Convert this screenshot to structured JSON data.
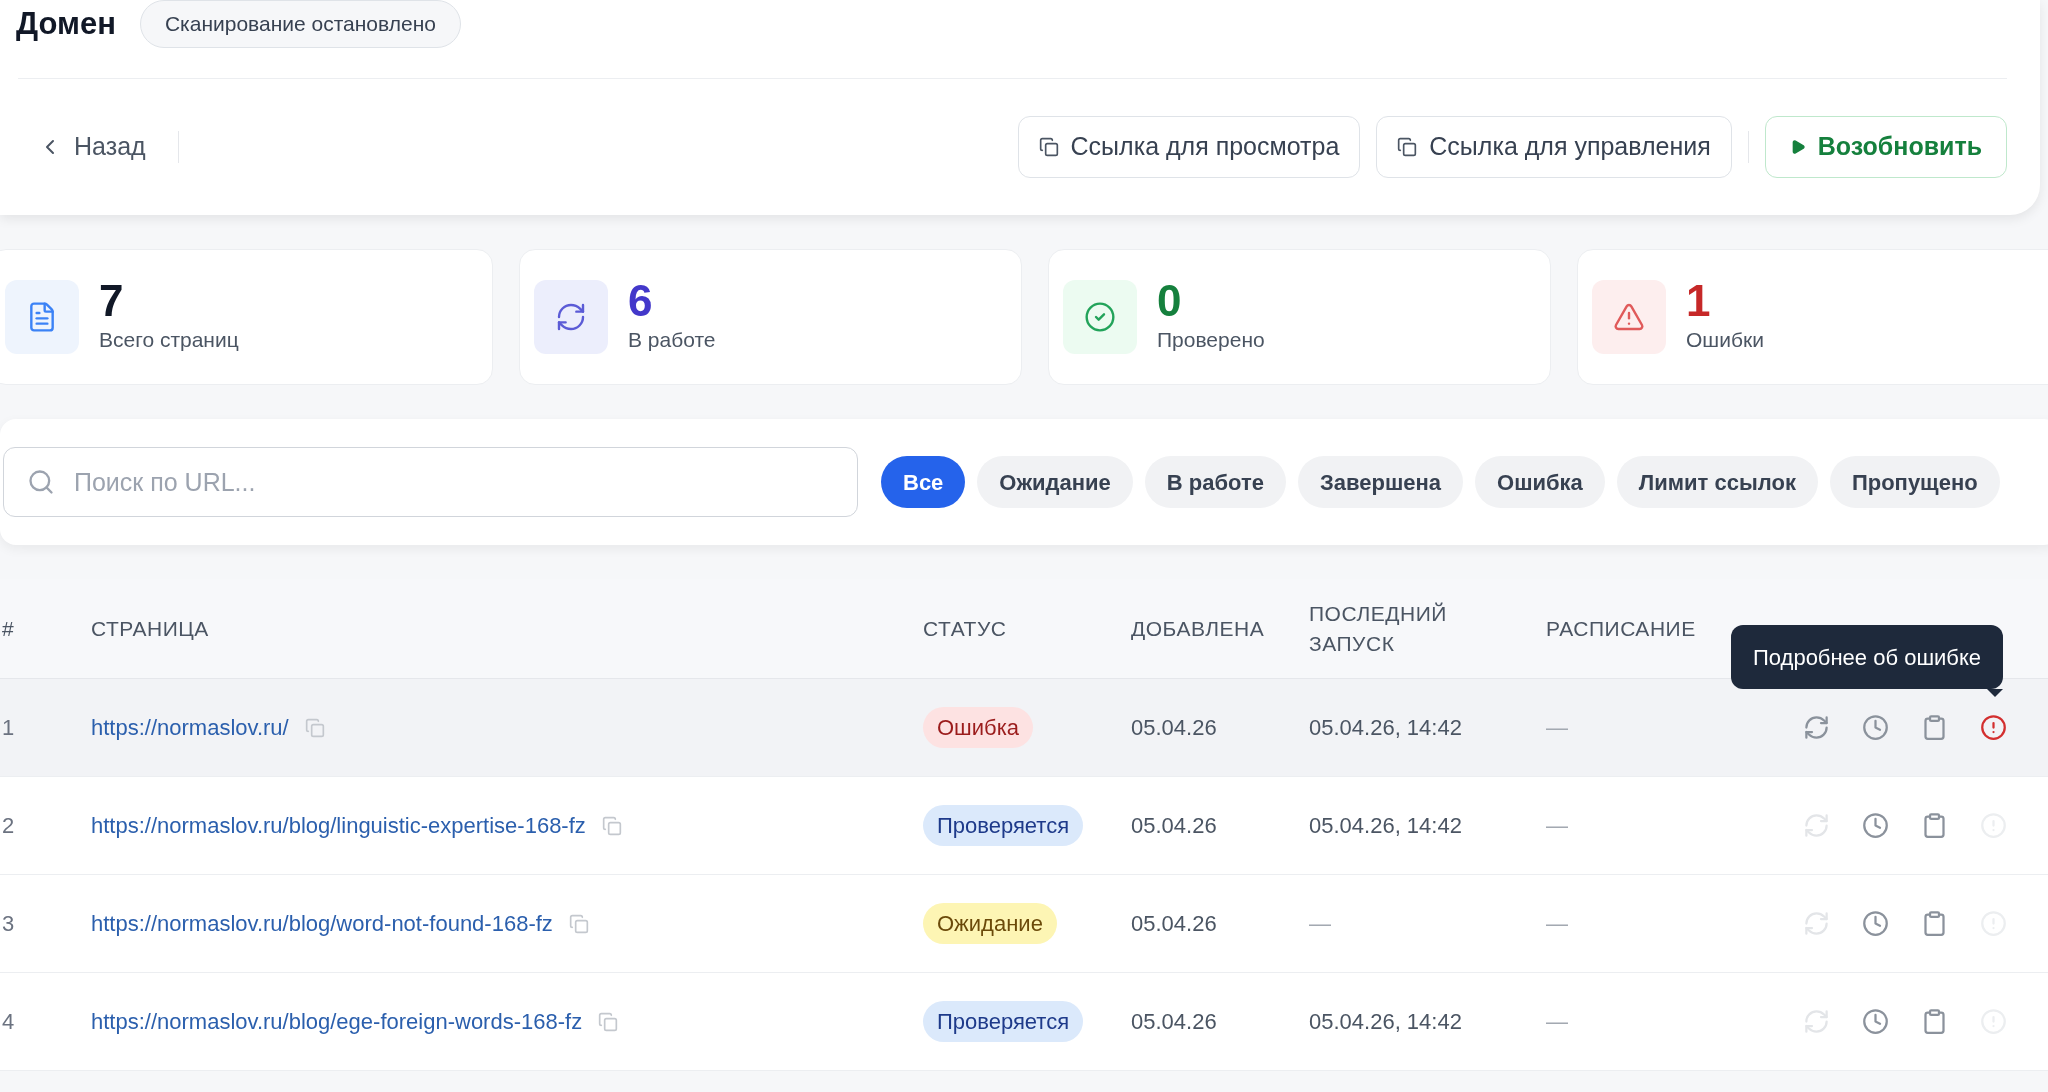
{
  "header": {
    "title": "Домен",
    "status_badge": "Сканирование остановлено"
  },
  "nav": {
    "back": "Назад",
    "buttons": [
      {
        "kind": "copy",
        "label": "Ссылка для просмотра"
      },
      {
        "kind": "copy",
        "label": "Ссылка для управления"
      },
      {
        "kind": "resume",
        "label": "Возобновить"
      }
    ]
  },
  "stats": [
    {
      "kind": "pages",
      "value": "7",
      "label": "Всего страниц"
    },
    {
      "kind": "working",
      "value": "6",
      "label": "В работе"
    },
    {
      "kind": "checked",
      "value": "0",
      "label": "Проверено"
    },
    {
      "kind": "errors",
      "value": "1",
      "label": "Ошибки"
    }
  ],
  "search": {
    "placeholder": "Поиск по URL..."
  },
  "filters": [
    {
      "label": "Все",
      "selected": true
    },
    {
      "label": "Ожидание",
      "selected": false
    },
    {
      "label": "В работе",
      "selected": false
    },
    {
      "label": "Завершена",
      "selected": false
    },
    {
      "label": "Ошибка",
      "selected": false
    },
    {
      "label": "Лимит ссылок",
      "selected": false
    },
    {
      "label": "Пропущено",
      "selected": false
    }
  ],
  "table": {
    "columns": [
      "#",
      "СТРАНИЦА",
      "СТАТУС",
      "ДОБАВЛЕНА",
      "ПОСЛЕДНИЙ ЗАПУСК",
      "РАСПИСАНИЕ"
    ],
    "rows": [
      {
        "index": "1",
        "url": "https://normaslov.ru/",
        "status": {
          "kind": "error",
          "label": "Ошибка"
        },
        "added": "05.04.26",
        "last_run": "05.04.26, 14:42",
        "schedule": "—",
        "highlighted": true,
        "retry_enabled": true,
        "error_details_enabled": true
      },
      {
        "index": "2",
        "url": "https://normaslov.ru/blog/linguistic-expertise-168-fz",
        "status": {
          "kind": "checking",
          "label": "Проверяется"
        },
        "added": "05.04.26",
        "last_run": "05.04.26, 14:42",
        "schedule": "—",
        "highlighted": false,
        "retry_enabled": false,
        "error_details_enabled": false
      },
      {
        "index": "3",
        "url": "https://normaslov.ru/blog/word-not-found-168-fz",
        "status": {
          "kind": "waiting",
          "label": "Ожидание"
        },
        "added": "05.04.26",
        "last_run": "—",
        "schedule": "—",
        "highlighted": false,
        "retry_enabled": false,
        "error_details_enabled": false
      },
      {
        "index": "4",
        "url": "https://normaslov.ru/blog/ege-foreign-words-168-fz",
        "status": {
          "kind": "checking",
          "label": "Проверяется"
        },
        "added": "05.04.26",
        "last_run": "05.04.26, 14:42",
        "schedule": "—",
        "highlighted": false,
        "retry_enabled": false,
        "error_details_enabled": false
      }
    ]
  },
  "tooltip": {
    "text": "Подробнее об ошибке"
  }
}
